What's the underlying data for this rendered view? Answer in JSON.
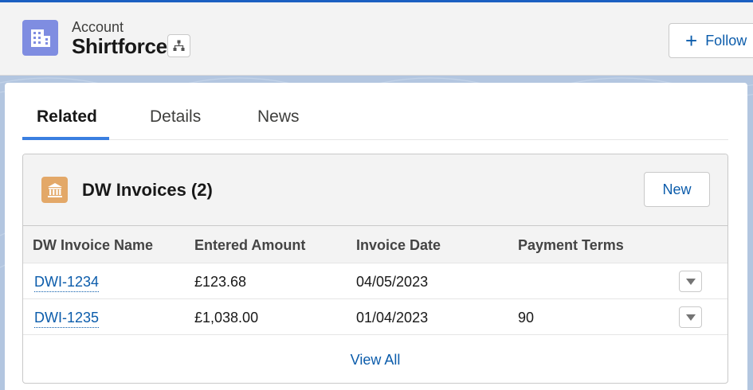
{
  "header": {
    "object_label": "Account",
    "record_name": "Shirtforce",
    "follow_label": "Follow",
    "icon": "building-icon"
  },
  "tabs": [
    {
      "label": "Related",
      "active": true
    },
    {
      "label": "Details",
      "active": false
    },
    {
      "label": "News",
      "active": false
    }
  ],
  "related_list": {
    "title": "DW Invoices (2)",
    "icon": "bank-icon",
    "new_label": "New",
    "columns": [
      "DW Invoice Name",
      "Entered Amount",
      "Invoice Date",
      "Payment Terms"
    ],
    "rows": [
      {
        "name": "DWI-1234",
        "amount": "£123.68",
        "date": "04/05/2023",
        "terms": ""
      },
      {
        "name": "DWI-1235",
        "amount": "£1,038.00",
        "date": "01/04/2023",
        "terms": "90"
      }
    ],
    "view_all_label": "View All"
  },
  "colors": {
    "brand_blue": "#0b5cab",
    "account_icon": "#7f8de1",
    "invoice_icon": "#e3a868",
    "tab_indicator": "#3a7fe0"
  }
}
